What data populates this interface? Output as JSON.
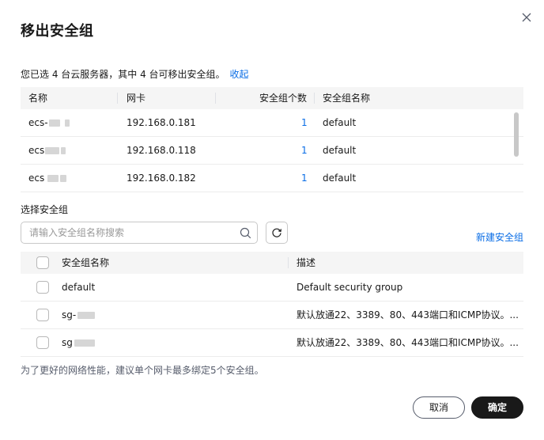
{
  "dialog": {
    "title": "移出安全组",
    "summary_text": "您已选 4 台云服务器，其中 4 台可移出安全组。",
    "collapse_link": "收起"
  },
  "server_table": {
    "headers": [
      "名称",
      "网卡",
      "安全组个数",
      "安全组名称"
    ],
    "rows": [
      {
        "name_prefix": "ecs-",
        "nic": "192.168.0.181",
        "sg_count": "1",
        "sg_name": "default"
      },
      {
        "name_prefix": "ecs",
        "nic": "192.168.0.118",
        "sg_count": "1",
        "sg_name": "default"
      },
      {
        "name_prefix": "ecs",
        "nic": "192.168.0.182",
        "sg_count": "1",
        "sg_name": "default"
      }
    ]
  },
  "select_section": {
    "label": "选择安全组",
    "search_placeholder": "请输入安全组名称搜索",
    "new_sg_link": "新建安全组"
  },
  "sg_table": {
    "headers": [
      "安全组名称",
      "描述"
    ],
    "rows": [
      {
        "name": "default",
        "description": "Default security group"
      },
      {
        "name": "sg-",
        "description": "默认放通22、3389、80、443端口和ICMP协议。..."
      },
      {
        "name": "sg",
        "description": "默认放通22、3389、80、443端口和ICMP协议。..."
      }
    ]
  },
  "hint": "为了更好的网络性能，建议单个网卡最多绑定5个安全组。",
  "footer": {
    "cancel_label": "取消",
    "ok_label": "确定"
  },
  "colors": {
    "link": "#0a6de6",
    "primary_button": "#191919",
    "header_bg": "#f5f5f5"
  },
  "icons": {
    "close": "close-icon",
    "search": "search-icon",
    "refresh": "refresh-icon"
  }
}
